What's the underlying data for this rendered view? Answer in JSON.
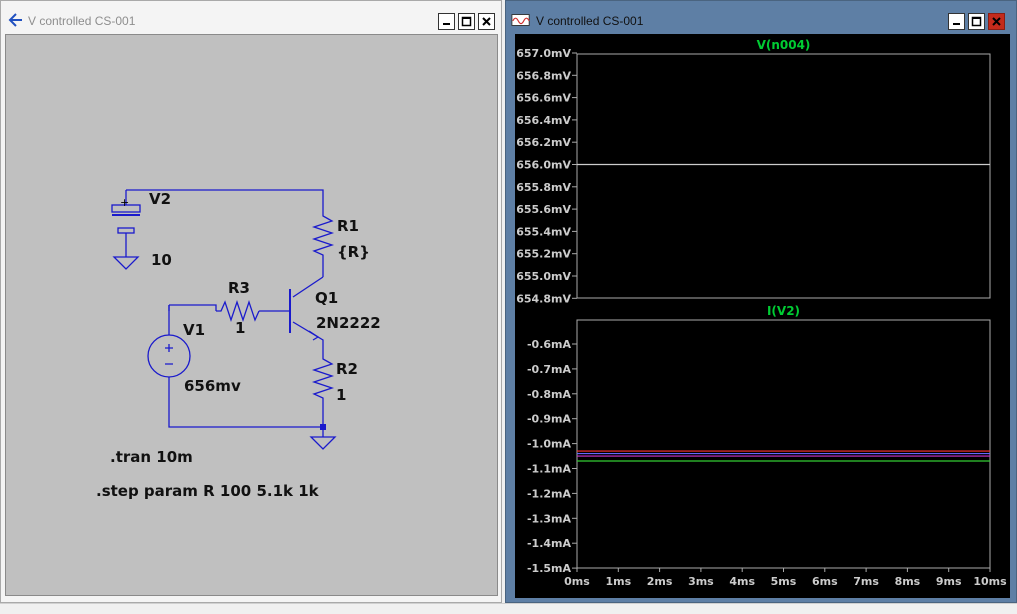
{
  "schematic_window": {
    "title": "V controlled CS-001",
    "colors": {
      "wire": "#1a1acc",
      "background": "#c0c0c0",
      "text": "#000000"
    },
    "components": [
      {
        "id": "V2",
        "value": "10"
      },
      {
        "id": "R1",
        "value": "{R}"
      },
      {
        "id": "R3",
        "value": "1"
      },
      {
        "id": "Q1",
        "value": "2N2222"
      },
      {
        "id": "V1",
        "value": "656mv"
      },
      {
        "id": "R2",
        "value": "1"
      }
    ],
    "directives": [
      ".tran 10m",
      ".step param R 100 5.1k 1k"
    ]
  },
  "plot_window": {
    "title": "V controlled CS-001",
    "colors": {
      "trace_label": "#00cc33",
      "axis_text": "#cccccc",
      "frame": "#aaaaaa",
      "background": "#000000"
    }
  },
  "chart_data": [
    {
      "type": "line",
      "title": "V(n004)",
      "y_ticks": [
        "657.0mV",
        "656.8mV",
        "656.6mV",
        "656.4mV",
        "656.2mV",
        "656.0mV",
        "655.8mV",
        "655.6mV",
        "655.4mV",
        "655.2mV",
        "655.0mV",
        "654.8mV"
      ],
      "ylim": [
        654.8,
        657.0
      ],
      "xlim": [
        0,
        10
      ],
      "series": [
        {
          "color": "#cccccc",
          "x": [
            0,
            10
          ],
          "y": [
            656.0,
            656.0
          ]
        }
      ]
    },
    {
      "type": "line",
      "title": "I(V2)",
      "y_ticks": [
        "-0.6mA",
        "-0.7mA",
        "-0.8mA",
        "-0.9mA",
        "-1.0mA",
        "-1.1mA",
        "-1.2mA",
        "-1.3mA",
        "-1.4mA",
        "-1.5mA"
      ],
      "x_ticks": [
        "0ms",
        "1ms",
        "2ms",
        "3ms",
        "4ms",
        "5ms",
        "6ms",
        "7ms",
        "8ms",
        "9ms",
        "10ms"
      ],
      "ylim": [
        -1.5,
        -0.55
      ],
      "xlim": [
        0,
        10
      ],
      "series": [
        {
          "color": "#ff3333",
          "x": [
            0,
            10
          ],
          "y": [
            -1.03,
            -1.03
          ]
        },
        {
          "color": "#6666ff",
          "x": [
            0,
            10
          ],
          "y": [
            -1.04,
            -1.04
          ]
        },
        {
          "color": "#cc33cc",
          "x": [
            0,
            10
          ],
          "y": [
            -1.05,
            -1.05
          ]
        },
        {
          "color": "#33cc33",
          "x": [
            0,
            10
          ],
          "y": [
            -1.07,
            -1.07
          ]
        }
      ]
    }
  ]
}
